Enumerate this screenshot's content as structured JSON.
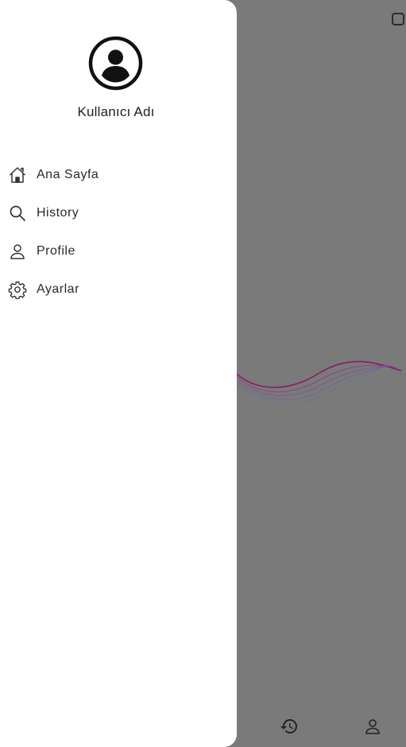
{
  "drawer": {
    "user_name": "Kullanıcı Adı",
    "avatar_icon": "account-circle-icon",
    "items": [
      {
        "label": "Ana Sayfa",
        "icon": "home-icon"
      },
      {
        "label": "History",
        "icon": "search-icon"
      },
      {
        "label": "Profile",
        "icon": "person-icon"
      },
      {
        "label": "Ayarlar",
        "icon": "gear-icon"
      }
    ]
  },
  "bottom_nav": {
    "items": [
      {
        "icon": "history-icon"
      },
      {
        "icon": "person-icon"
      }
    ]
  },
  "colors": {
    "scrim": "#7a7a7a",
    "drawer_bg": "#ffffff",
    "text": "#2a2a2a",
    "wave_primary": "#8b1a6b",
    "wave_secondary": "#6a5aa0"
  }
}
